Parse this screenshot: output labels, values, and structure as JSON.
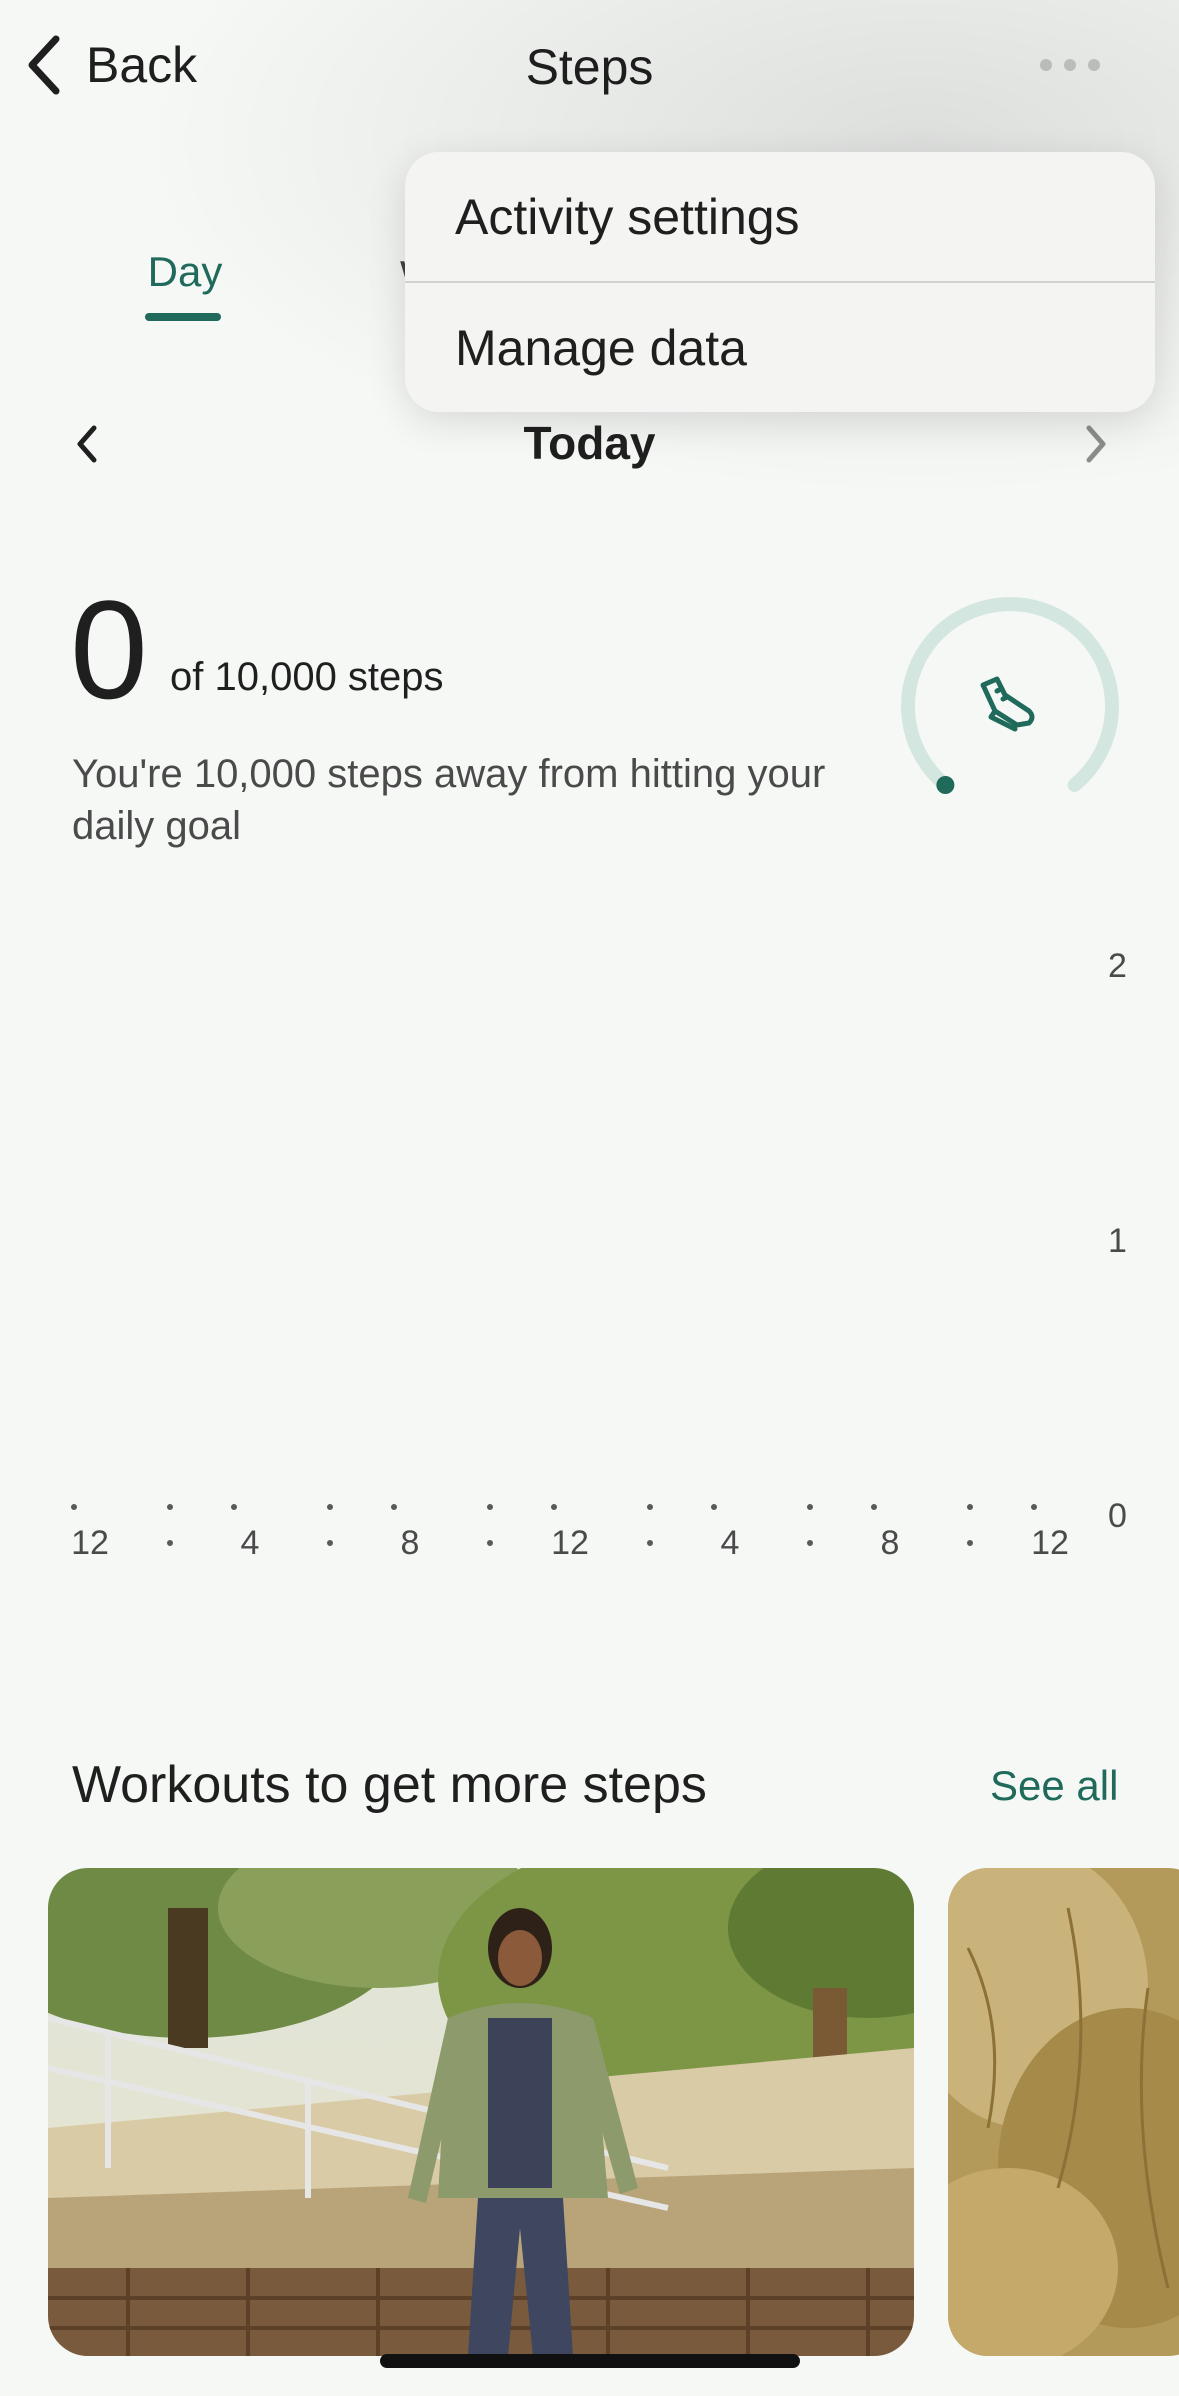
{
  "header": {
    "back_label": "Back",
    "title": "Steps",
    "more_icon": "more-horizontal-icon"
  },
  "tabs": {
    "active": "Day",
    "partial_next": "W"
  },
  "date_nav": {
    "label": "Today",
    "prev_icon": "chevron-left-icon",
    "next_icon": "chevron-right-icon"
  },
  "summary": {
    "count": "0",
    "goal": "of 10,000 steps",
    "message": "You're 10,000 steps away from hitting your daily goal",
    "progress_fraction": 0,
    "ring_icon": "shoe-icon"
  },
  "chart_data": {
    "type": "bar",
    "categories": [
      "12",
      "4",
      "8",
      "12",
      "4",
      "8",
      "12"
    ],
    "values": [],
    "y_ticks": [
      "2",
      "1",
      "0"
    ],
    "ylim": [
      0,
      2
    ]
  },
  "workouts": {
    "title": "Workouts to get more steps",
    "see_all": "See all"
  },
  "menu": {
    "items": [
      "Activity settings",
      "Manage data"
    ]
  },
  "colors": {
    "accent": "#1f6a5a",
    "ring_track": "#d3e6e0",
    "background": "#f6f8f6"
  }
}
